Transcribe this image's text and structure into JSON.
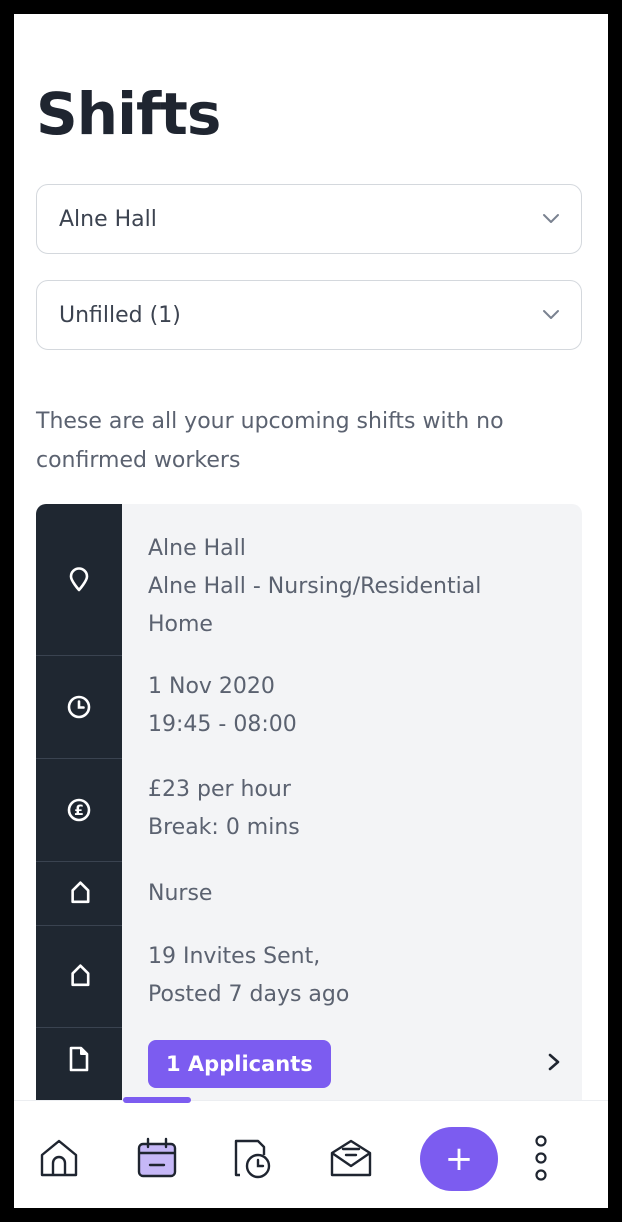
{
  "page": {
    "title": "Shifts"
  },
  "filters": {
    "location": {
      "value": "Alne Hall"
    },
    "status": {
      "value": "Unfilled (1)"
    }
  },
  "description": "These are all your upcoming shifts with no confirmed workers",
  "shift": {
    "location_name": "Alne Hall",
    "location_detail_1": "Alne Hall - Nursing/Residential",
    "location_detail_2": "Home",
    "date": "1 Nov 2020",
    "time": "19:45 - 08:00",
    "rate": "£23 per hour",
    "break": "Break: 0 mins",
    "role": "Nurse",
    "invites": "19 Invites Sent,",
    "posted": "Posted 7 days ago",
    "applicants_badge": "1 Applicants"
  },
  "nav": {
    "items": [
      "home-icon",
      "calendar-icon",
      "timesheet-icon",
      "inbox-icon",
      "add-icon",
      "more-icon"
    ],
    "add_label": "+",
    "accent": "#7c5cf0"
  }
}
